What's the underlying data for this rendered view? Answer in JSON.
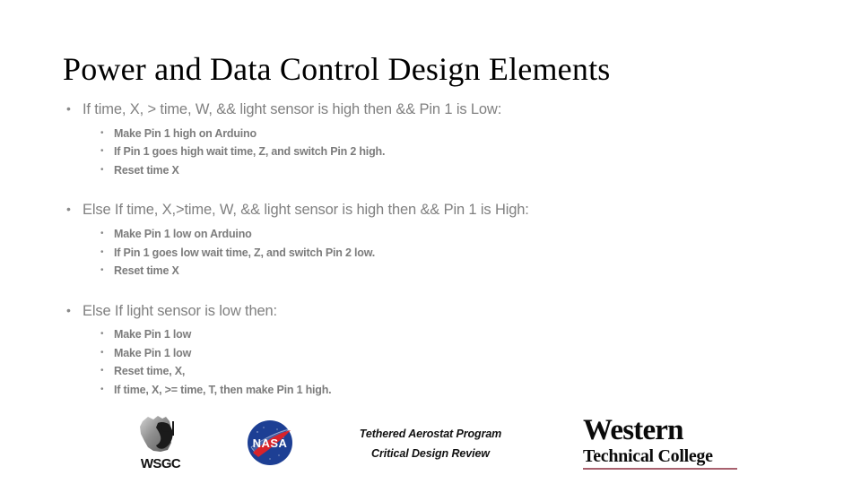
{
  "slide": {
    "title": "Power and Data Control Design Elements",
    "background_color": "#ffffff",
    "body_text_color": "#808080",
    "sub_text_color": "#7c7c7c",
    "bullet_glyph": "•",
    "groups": [
      {
        "heading": "If time, X, > time, W, && light sensor is high then && Pin 1 is Low:",
        "items": [
          "Make Pin 1 high on Arduino",
          "If Pin 1 goes high wait time, Z, and switch Pin 2 high.",
          "Reset time X"
        ]
      },
      {
        "heading": "Else If time, X,>time, W, && light sensor is high then && Pin 1 is High:",
        "items": [
          "Make Pin 1 low on Arduino",
          "If Pin 1 goes low wait time, Z, and switch Pin 2 low.",
          "Reset time X"
        ]
      },
      {
        "heading": "Else If light sensor is low then:",
        "items": [
          "Make Pin 1 low",
          "Make Pin 1 low",
          "Reset time, X,",
          "If time, X, >= time, T, then make Pin 1 high."
        ]
      }
    ]
  },
  "footer": {
    "wsgc": {
      "wordmark": "WSGC",
      "map_color": "#9a9a9a",
      "figure_color": "#1b1b1b"
    },
    "nasa": {
      "label": "NASA",
      "circle_color": "#1d3f94",
      "swoosh_color": "#d8232a",
      "text_color": "#ffffff"
    },
    "program": {
      "line1": "Tethered Aerostat Program",
      "line2": "Critical Design Review"
    },
    "western": {
      "line1": "Western",
      "line2": "Technical College",
      "rule_color": "#a8616e"
    }
  }
}
